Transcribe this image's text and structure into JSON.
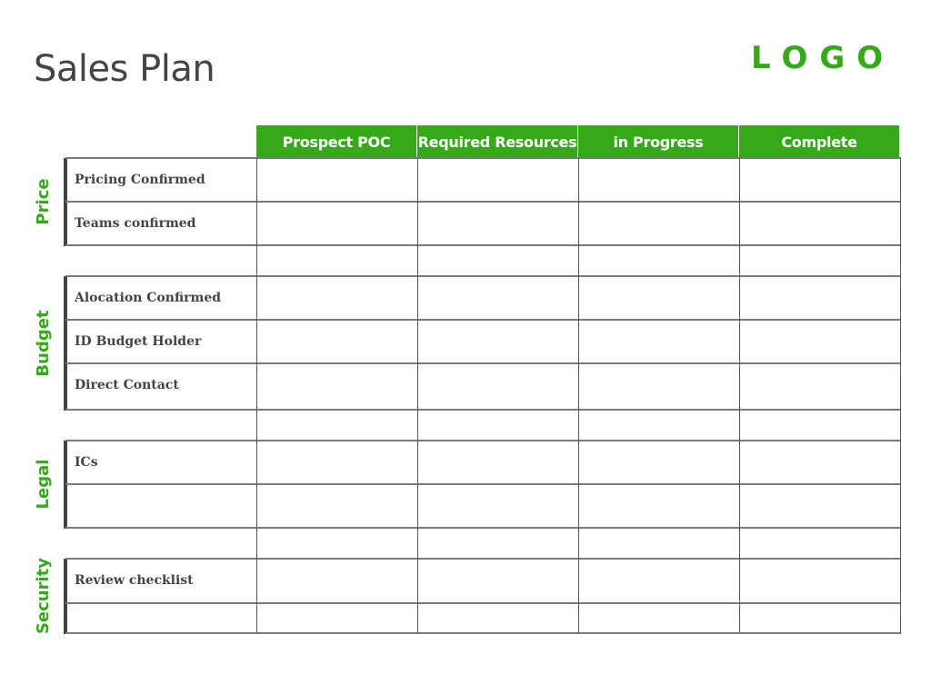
{
  "page": {
    "title": "Sales Plan",
    "logo": "LOGO"
  },
  "colors": {
    "accent": "#36a91a",
    "text": "#444444",
    "grid": "#7a7a7a"
  },
  "table": {
    "columns": [
      "Prospect POC",
      "Required Resources",
      "in Progress",
      "Complete"
    ],
    "sections": [
      {
        "label": "Price",
        "rows": [
          "Pricing Confirmed",
          "Teams confirmed"
        ]
      },
      {
        "label": "Budget",
        "rows": [
          "Alocation Confirmed",
          "ID Budget Holder",
          "Direct Contact"
        ]
      },
      {
        "label": "Legal",
        "rows": [
          "ICs",
          ""
        ]
      },
      {
        "label": "Security",
        "rows": [
          "Review checklist",
          ""
        ]
      }
    ]
  }
}
